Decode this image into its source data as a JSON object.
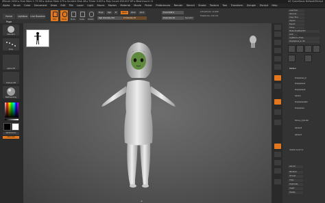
{
  "titlebar": {
    "app": "ZBrush 2020",
    "stats": "▸ Free Mem 1.73 GB ▸ Active Mem 475 ▸ Scratch Disk 48 ▸ Timer 0.003 ▸ Poly Count 450.007 KP ▸ MeshCount 11",
    "right": "AC  QuickSave  DefaultZScript"
  },
  "menu": [
    "Alpha",
    "Brush",
    "Color",
    "Document",
    "Draw",
    "Edit",
    "File",
    "Layer",
    "Light",
    "Macro",
    "Marker",
    "Material",
    "Movie",
    "Picker",
    "Preferences",
    "Render",
    "Stencil",
    "Stroke",
    "Texture",
    "Tool",
    "Transform",
    "Zplugin",
    "Zscript",
    "Help"
  ],
  "tabs": {
    "home": "Home Page",
    "lightbox": "Lightbox",
    "liveboolean": "Live Boolean"
  },
  "toolbar": {
    "edit": "Edit",
    "draw": "Draw",
    "move": "Move",
    "scale": "Scale",
    "rotate": "Rotate",
    "mrgb": "Mrgb",
    "rgb": "Rgb",
    "m": "M",
    "zadd": "Zadd",
    "zsub": "Zsub",
    "zcut": "Zcut",
    "rgb_intensity": "Rgb Intensity 100",
    "z_intensity": "Z Intensity 25",
    "focal_shift": "Focal Shift 0",
    "draw_size": "Draw Size 64",
    "dynamic": "Dynamic",
    "active_points": "ActivePoints: 10,908",
    "total_points": "TotalPoints: 230,722"
  },
  "left": {
    "brush": "Standard",
    "stroke": "Dots",
    "alpha": "Alpha Off",
    "texture": "Texture Off",
    "material": "MatCap Gray",
    "gradient": "Gradient",
    "switch": "SwitchColor",
    "alternate": "Alternate"
  },
  "tool": {
    "header": "Load Tool",
    "items": [
      "Load Tool",
      "Save As",
      "Copy Tool",
      "Import",
      "Export",
      "Clone",
      "Make PolyMesh3D",
      "GoZ",
      "All",
      "Visible",
      "R",
      "Lightbox ▸ Tools",
      "PolySphere_6. 48"
    ],
    "subtool_label": "Subtool",
    "subtools": [
      "PolySphere_6",
      "PolySphere1",
      "PolySphere4",
      "Sphere",
      "PolySphere002",
      "PolySphere",
      "Skinny_Cylinder",
      "Sphere5",
      "Sphere7",
      "Visible Count 11"
    ],
    "bottom": [
      "List All",
      "Auto Collapse",
      "Rename",
      "AutoReorder",
      "All Low",
      "All High",
      "Copy",
      "Paste",
      "Duplicate",
      "Append",
      "Insert",
      "Delete"
    ]
  },
  "status": {
    "bottom_center": "◂▸"
  },
  "colors": {
    "accent": "#e2771e",
    "bg": "#2b2b2b"
  }
}
